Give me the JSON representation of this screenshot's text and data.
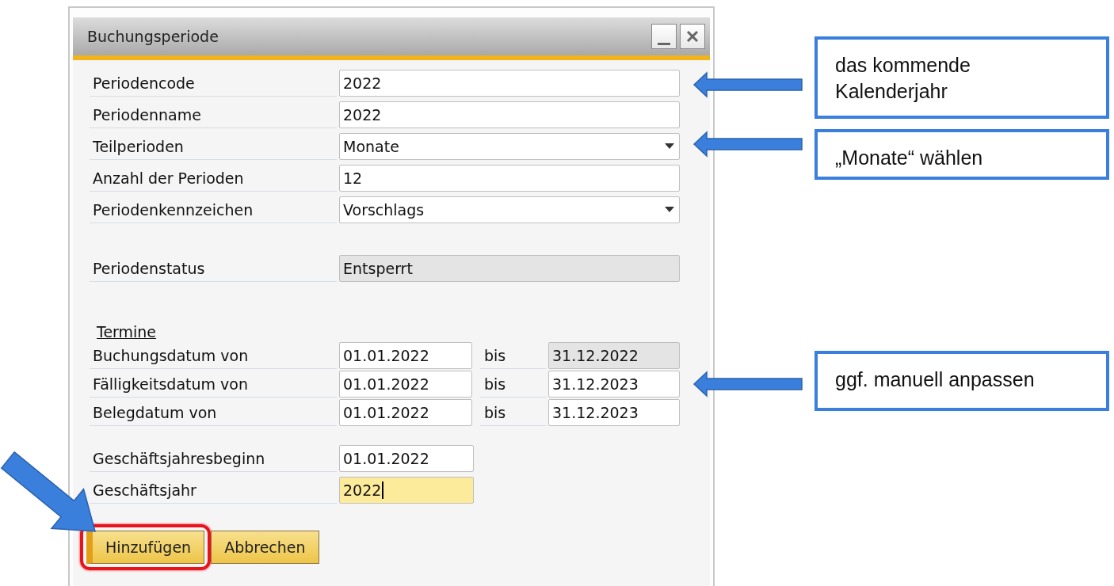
{
  "window": {
    "title": "Buchungsperiode"
  },
  "field_groups": [
    {
      "fields": [
        {
          "label": "Periodencode",
          "kind": "text",
          "value": "2022",
          "disabled": false
        },
        {
          "label": "Periodenname",
          "kind": "text",
          "value": "2022",
          "disabled": false
        },
        {
          "label": "Teilperioden",
          "kind": "dropdown",
          "value": "Monate",
          "disabled": false
        },
        {
          "label": "Anzahl der Perioden",
          "kind": "text",
          "value": "12",
          "disabled": false
        },
        {
          "label": "Periodenkennzeichen",
          "kind": "dropdown",
          "value": "Vorschlags",
          "disabled": false
        }
      ]
    },
    {
      "fields": [
        {
          "label": "Periodenstatus",
          "kind": "text",
          "value": "Entsperrt",
          "disabled": true
        }
      ]
    }
  ],
  "dates": {
    "heading": "Termine",
    "rows": [
      {
        "label": "Buchungsdatum von",
        "from": "01.01.2022",
        "separator": "bis",
        "to": "31.12.2022",
        "to_disabled": true
      },
      {
        "label": "Fälligkeitsdatum von",
        "from": "01.01.2022",
        "separator": "bis",
        "to": "31.12.2023",
        "to_disabled": false
      },
      {
        "label": "Belegdatum von",
        "from": "01.01.2022",
        "separator": "bis",
        "to": "31.12.2023",
        "to_disabled": false
      }
    ]
  },
  "fiscal": [
    {
      "label": "Geschäftsjahresbeginn",
      "value": "01.01.2022",
      "focused": false
    },
    {
      "label": "Geschäftsjahr",
      "value": "2022",
      "focused": true
    }
  ],
  "buttons": [
    {
      "label": "Hinzufügen",
      "highlighted": true
    },
    {
      "label": "Abbrechen",
      "highlighted": false
    }
  ],
  "callouts": [
    {
      "text": "das kommende Kalenderjahr"
    },
    {
      "text": "„Monate“ wählen"
    },
    {
      "text": "ggf. manuell anpassen"
    }
  ]
}
